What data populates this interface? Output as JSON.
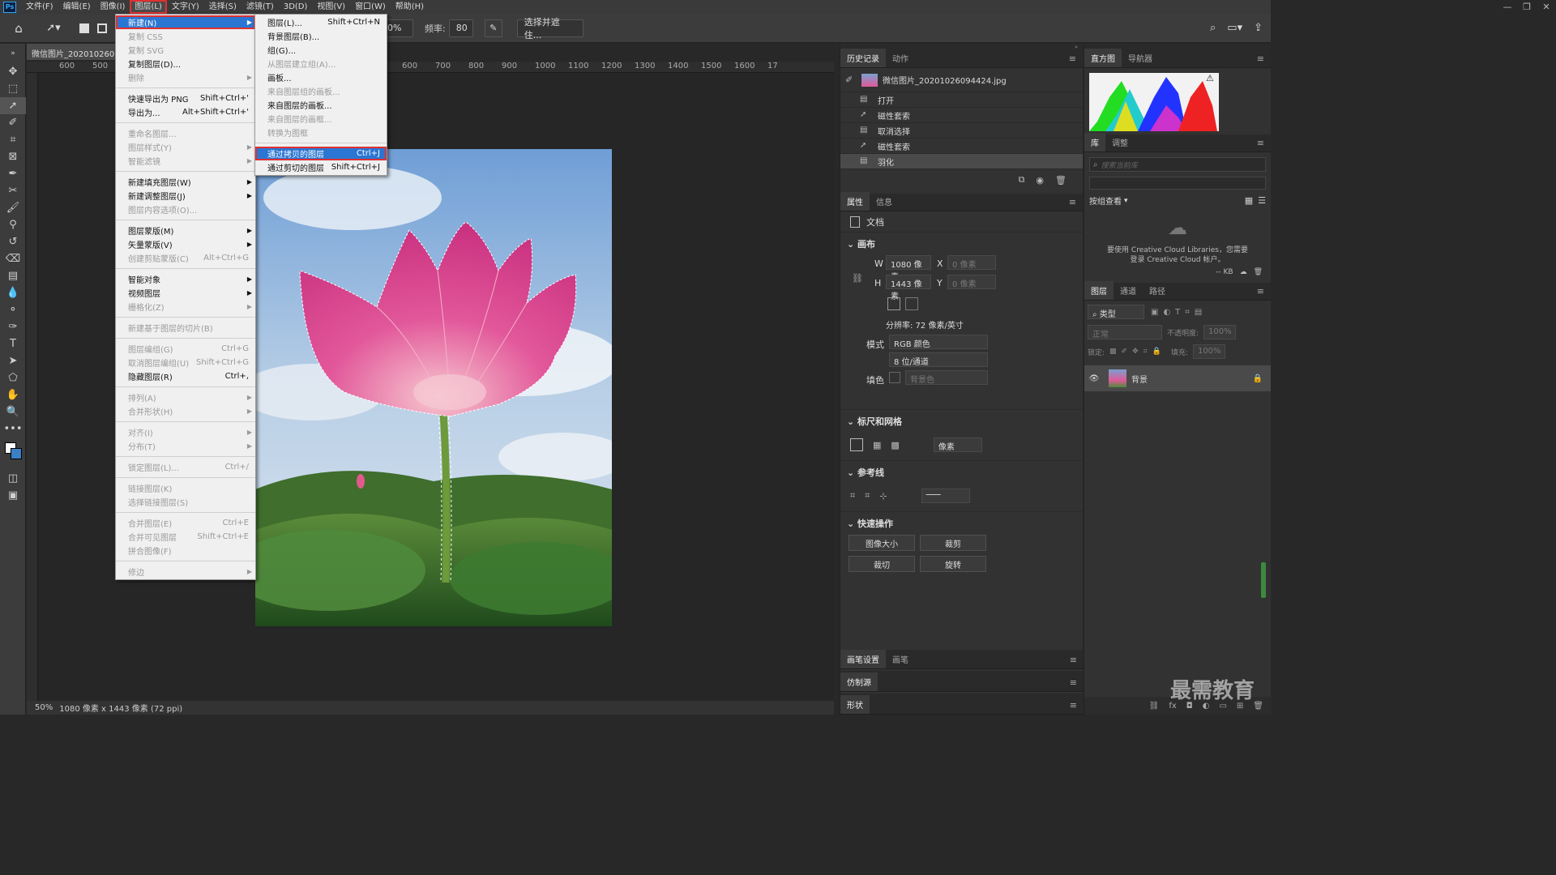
{
  "app": {
    "logo": "Ps"
  },
  "menubar": {
    "items": [
      "文件(F)",
      "编辑(E)",
      "图像(I)",
      "图层(L)",
      "文字(Y)",
      "选择(S)",
      "滤镜(T)",
      "3D(D)",
      "视图(V)",
      "窗口(W)",
      "帮助(H)"
    ]
  },
  "window_controls": [
    "—",
    "❐",
    "✕"
  ],
  "options_bar": {
    "contrast_value": "10%",
    "frequency_label": "频率:",
    "frequency_value": "80",
    "select_mask_button": "选择并遮住..."
  },
  "document": {
    "tab_title": "微信图片_2020102609",
    "ruler_ticks": [
      "600",
      "500",
      "400",
      "500",
      "600",
      "700",
      "800",
      "900",
      "1000",
      "1100",
      "1200",
      "1300",
      "1400",
      "1500",
      "1600",
      "17"
    ],
    "status": {
      "zoom": "50%",
      "info": "1080 像素 x 1443 像素 (72 ppi)"
    }
  },
  "layer_menu": {
    "items": [
      {
        "label": "新建(N)",
        "shortcut": "",
        "submenu": true,
        "state": "highlighted"
      },
      {
        "label": "复制 CSS",
        "shortcut": "",
        "submenu": false,
        "state": "disabled"
      },
      {
        "label": "复制 SVG",
        "shortcut": "",
        "submenu": false,
        "state": "disabled"
      },
      {
        "label": "复制图层(D)...",
        "shortcut": "",
        "submenu": false,
        "state": "normal"
      },
      {
        "label": "删除",
        "shortcut": "",
        "submenu": true,
        "state": "disabled"
      },
      {
        "sep": true
      },
      {
        "label": "快速导出为 PNG",
        "shortcut": "Shift+Ctrl+'",
        "submenu": false,
        "state": "normal"
      },
      {
        "label": "导出为...",
        "shortcut": "Alt+Shift+Ctrl+'",
        "submenu": false,
        "state": "normal"
      },
      {
        "sep": true
      },
      {
        "label": "重命名图层...",
        "shortcut": "",
        "submenu": false,
        "state": "disabled"
      },
      {
        "label": "图层样式(Y)",
        "shortcut": "",
        "submenu": true,
        "state": "disabled"
      },
      {
        "label": "智能滤镜",
        "shortcut": "",
        "submenu": true,
        "state": "disabled"
      },
      {
        "sep": true
      },
      {
        "label": "新建填充图层(W)",
        "shortcut": "",
        "submenu": true,
        "state": "normal"
      },
      {
        "label": "新建调整图层(J)",
        "shortcut": "",
        "submenu": true,
        "state": "normal"
      },
      {
        "label": "图层内容选项(O)...",
        "shortcut": "",
        "submenu": false,
        "state": "disabled"
      },
      {
        "sep": true
      },
      {
        "label": "图层蒙版(M)",
        "shortcut": "",
        "submenu": true,
        "state": "normal"
      },
      {
        "label": "矢量蒙版(V)",
        "shortcut": "",
        "submenu": true,
        "state": "normal"
      },
      {
        "label": "创建剪贴蒙版(C)",
        "shortcut": "Alt+Ctrl+G",
        "submenu": false,
        "state": "disabled"
      },
      {
        "sep": true
      },
      {
        "label": "智能对象",
        "shortcut": "",
        "submenu": true,
        "state": "normal"
      },
      {
        "label": "视频图层",
        "shortcut": "",
        "submenu": true,
        "state": "normal"
      },
      {
        "label": "栅格化(Z)",
        "shortcut": "",
        "submenu": true,
        "state": "disabled"
      },
      {
        "sep": true
      },
      {
        "label": "新建基于图层的切片(B)",
        "shortcut": "",
        "submenu": false,
        "state": "disabled"
      },
      {
        "sep": true
      },
      {
        "label": "图层编组(G)",
        "shortcut": "Ctrl+G",
        "submenu": false,
        "state": "disabled"
      },
      {
        "label": "取消图层编组(U)",
        "shortcut": "Shift+Ctrl+G",
        "submenu": false,
        "state": "disabled"
      },
      {
        "label": "隐藏图层(R)",
        "shortcut": "Ctrl+,",
        "submenu": false,
        "state": "normal"
      },
      {
        "sep": true
      },
      {
        "label": "排列(A)",
        "shortcut": "",
        "submenu": true,
        "state": "disabled"
      },
      {
        "label": "合并形状(H)",
        "shortcut": "",
        "submenu": true,
        "state": "disabled"
      },
      {
        "sep": true
      },
      {
        "label": "对齐(I)",
        "shortcut": "",
        "submenu": true,
        "state": "disabled"
      },
      {
        "label": "分布(T)",
        "shortcut": "",
        "submenu": true,
        "state": "disabled"
      },
      {
        "sep": true
      },
      {
        "label": "锁定图层(L)...",
        "shortcut": "Ctrl+/",
        "submenu": false,
        "state": "disabled"
      },
      {
        "sep": true
      },
      {
        "label": "链接图层(K)",
        "shortcut": "",
        "submenu": false,
        "state": "disabled"
      },
      {
        "label": "选择链接图层(S)",
        "shortcut": "",
        "submenu": false,
        "state": "disabled"
      },
      {
        "sep": true
      },
      {
        "label": "合并图层(E)",
        "shortcut": "Ctrl+E",
        "submenu": false,
        "state": "disabled"
      },
      {
        "label": "合并可见图层",
        "shortcut": "Shift+Ctrl+E",
        "submenu": false,
        "state": "disabled"
      },
      {
        "label": "拼合图像(F)",
        "shortcut": "",
        "submenu": false,
        "state": "disabled"
      },
      {
        "sep": true
      },
      {
        "label": "修边",
        "shortcut": "",
        "submenu": true,
        "state": "disabled"
      }
    ]
  },
  "new_submenu": {
    "items": [
      {
        "label": "图层(L)...",
        "shortcut": "Shift+Ctrl+N",
        "state": "normal"
      },
      {
        "label": "背景图层(B)...",
        "shortcut": "",
        "state": "normal"
      },
      {
        "label": "组(G)...",
        "shortcut": "",
        "state": "normal"
      },
      {
        "label": "从图层建立组(A)...",
        "shortcut": "",
        "state": "disabled"
      },
      {
        "label": "画板...",
        "shortcut": "",
        "state": "normal"
      },
      {
        "label": "来自图层组的画板...",
        "shortcut": "",
        "state": "disabled"
      },
      {
        "label": "来自图层的画板...",
        "shortcut": "",
        "state": "normal"
      },
      {
        "label": "来自图层的画框...",
        "shortcut": "",
        "state": "disabled"
      },
      {
        "label": "转换为图框",
        "shortcut": "",
        "state": "disabled"
      },
      {
        "sep": true
      },
      {
        "label": "通过拷贝的图层",
        "shortcut": "Ctrl+J",
        "state": "highlighted"
      },
      {
        "label": "通过剪切的图层",
        "shortcut": "Shift+Ctrl+J",
        "state": "normal"
      }
    ]
  },
  "history_panel": {
    "tabs": [
      "历史记录",
      "动作"
    ],
    "snapshot": "微信图片_20201026094424.jpg",
    "steps": [
      "打开",
      "磁性套索",
      "取消选择",
      "磁性套索",
      "羽化"
    ]
  },
  "properties_panel": {
    "tabs": [
      "属性",
      "信息"
    ],
    "doc_label": "文档",
    "canvas_section": "画布",
    "w_label": "W",
    "w_value": "1080 像素",
    "h_label": "H",
    "h_value": "1443 像素",
    "x_label": "X",
    "x_placeholder": "0 像素",
    "y_label": "Y",
    "y_placeholder": "0 像素",
    "resolution": "分辨率: 72 像素/英寸",
    "mode_label": "模式",
    "mode_value": "RGB 颜色",
    "depth_value": "8 位/通道",
    "fill_label": "填色",
    "fill_value": "背景色",
    "rulers_section": "标尺和网格",
    "unit_value": "像素",
    "guides_section": "参考线",
    "quick_section": "快速操作",
    "quick_buttons": [
      "图像大小",
      "裁剪",
      "裁切",
      "旋转"
    ]
  },
  "bottom_mid_panels": [
    {
      "tabs": [
        "画笔设置",
        "画笔"
      ]
    },
    {
      "tabs": [
        "仿制源"
      ]
    },
    {
      "tabs": [
        "形状"
      ]
    }
  ],
  "histogram_panel": {
    "tabs": [
      "直方图",
      "导航器"
    ],
    "warning": "⚠"
  },
  "library_panel": {
    "tabs": [
      "库",
      "调整"
    ],
    "search_placeholder": "搜索当前库",
    "view_label": "按组查看",
    "message": "要使用 Creative Cloud Libraries，您需要登录 Creative Cloud 帐户。",
    "size": "-- KB"
  },
  "layers_panel": {
    "tabs": [
      "图层",
      "通道",
      "路径"
    ],
    "kind_label": "类型",
    "blend_mode": "正常",
    "opacity_label": "不透明度:",
    "opacity_value": "100%",
    "lock_label": "锁定:",
    "fill_label": "填充:",
    "fill_value": "100%",
    "layer_name": "背景"
  },
  "watermark": "最需教育",
  "colors": {
    "accent": "#2a76d2",
    "highlight_border": "#e03030"
  }
}
